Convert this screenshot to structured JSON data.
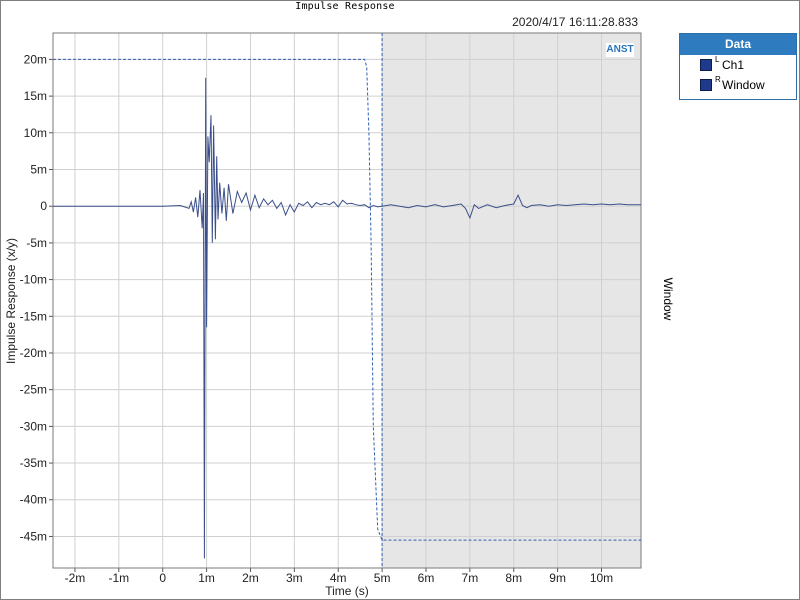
{
  "chart_data": {
    "type": "line",
    "title": "Impulse Response",
    "timestamp": "2020/4/17 16:11:28.833",
    "xlabel": "Time (s)",
    "ylabel": "Impulse Response (x/y)",
    "right_axis_label": "Window",
    "brand": "ANST",
    "xlim": [
      -0.0025,
      0.0109
    ],
    "ylim": [
      -0.0493,
      0.0236
    ],
    "x_ticks": [
      -0.002,
      -0.001,
      0,
      0.001,
      0.002,
      0.003,
      0.004,
      0.005,
      0.006,
      0.007,
      0.008,
      0.009,
      0.01
    ],
    "x_tick_labels": [
      "-2m",
      "-1m",
      "0",
      "1m",
      "2m",
      "3m",
      "4m",
      "5m",
      "6m",
      "7m",
      "8m",
      "9m",
      "10m"
    ],
    "y_ticks": [
      0.02,
      0.015,
      0.01,
      0.005,
      0,
      -0.005,
      -0.01,
      -0.015,
      -0.02,
      -0.025,
      -0.03,
      -0.035,
      -0.04,
      -0.045
    ],
    "y_tick_labels": [
      "20m",
      "15m",
      "10m",
      "5m",
      "0",
      "-5m",
      "-10m",
      "-15m",
      "-20m",
      "-25m",
      "-30m",
      "-35m",
      "-40m",
      "-45m"
    ],
    "grid": true,
    "legend_position": "outside-right",
    "legend_title": "Data",
    "colors": {
      "ch1": "#3a4f8a",
      "window": "#3060b0",
      "shade": "#e6e6e6",
      "legend_header": "#2e7bbf"
    },
    "shaded_region": [
      0.005,
      0.0109
    ],
    "cursor_x": 0.005,
    "series": [
      {
        "name": "Ch1",
        "channel": "L",
        "x": [
          -0.0025,
          0.0,
          0.0004,
          0.0006,
          0.00065,
          0.0007,
          0.00075,
          0.0008,
          0.00085,
          0.0009,
          0.00093,
          0.00095,
          0.00098,
          0.001,
          0.00103,
          0.00106,
          0.0011,
          0.00113,
          0.00116,
          0.0012,
          0.00123,
          0.00126,
          0.0013,
          0.00135,
          0.0014,
          0.00145,
          0.0015,
          0.0016,
          0.0017,
          0.0018,
          0.0019,
          0.002,
          0.0021,
          0.0022,
          0.0023,
          0.0024,
          0.0025,
          0.0026,
          0.0027,
          0.0028,
          0.0029,
          0.003,
          0.0031,
          0.0032,
          0.0033,
          0.0034,
          0.0035,
          0.0036,
          0.0037,
          0.0038,
          0.0039,
          0.004,
          0.0041,
          0.0042,
          0.0043,
          0.0044,
          0.0045,
          0.0046,
          0.0047,
          0.0048,
          0.0049,
          0.005,
          0.0052,
          0.0054,
          0.0056,
          0.0058,
          0.006,
          0.0062,
          0.0064,
          0.0066,
          0.0068,
          0.0069,
          0.007,
          0.0071,
          0.0072,
          0.0074,
          0.0076,
          0.0078,
          0.008,
          0.0081,
          0.0082,
          0.0083,
          0.0084,
          0.0086,
          0.0088,
          0.009,
          0.0092,
          0.0094,
          0.0096,
          0.0098,
          0.01,
          0.0102,
          0.0104,
          0.0106,
          0.0109
        ],
        "y": [
          0,
          0,
          0.0001,
          -0.0003,
          0.0006,
          -0.0008,
          0.0012,
          -0.0015,
          0.0022,
          -0.003,
          0.0018,
          -0.048,
          0.0175,
          -0.0165,
          0.0095,
          0.006,
          0.0124,
          -0.005,
          0.011,
          -0.0045,
          0.0068,
          -0.0018,
          0.0032,
          -0.001,
          0.0025,
          -0.002,
          0.003,
          -0.001,
          0.002,
          0.0005,
          0.0018,
          -0.0005,
          0.0015,
          -0.0002,
          0.001,
          0.0002,
          0.0008,
          -0.0003,
          0.0005,
          -0.0012,
          0.0002,
          -0.0008,
          0.0004,
          0.0001,
          0.0006,
          -0.0002,
          0.0005,
          0.0002,
          0.0004,
          0.0002,
          0.0006,
          -0.0001,
          0.0008,
          0.0003,
          0.0004,
          0.0002,
          0.0001,
          0.0002,
          -0.0002,
          0.0001,
          -0.0001,
          0.0,
          0.0002,
          0.0,
          -0.0002,
          0.0001,
          -0.0001,
          0.0002,
          -0.0001,
          0.0001,
          0.0003,
          -0.0003,
          -0.0016,
          0.0002,
          -0.0003,
          0.0002,
          -0.0002,
          0.0001,
          0.0003,
          0.0015,
          0.0001,
          -0.0002,
          0.0001,
          0.0002,
          0.0,
          0.0002,
          0.0001,
          0.0002,
          0.0003,
          0.0002,
          0.0003,
          0.0002,
          0.0003,
          0.0002,
          0.0002
        ]
      },
      {
        "name": "Window",
        "channel": "R",
        "x": [
          -0.0025,
          0.0046,
          0.00465,
          0.0047,
          0.00475,
          0.0048,
          0.0049,
          0.005,
          0.0109
        ],
        "y": [
          0.02,
          0.02,
          0.019,
          0.01,
          -0.005,
          -0.03,
          -0.044,
          -0.0455,
          -0.0455
        ]
      }
    ]
  }
}
